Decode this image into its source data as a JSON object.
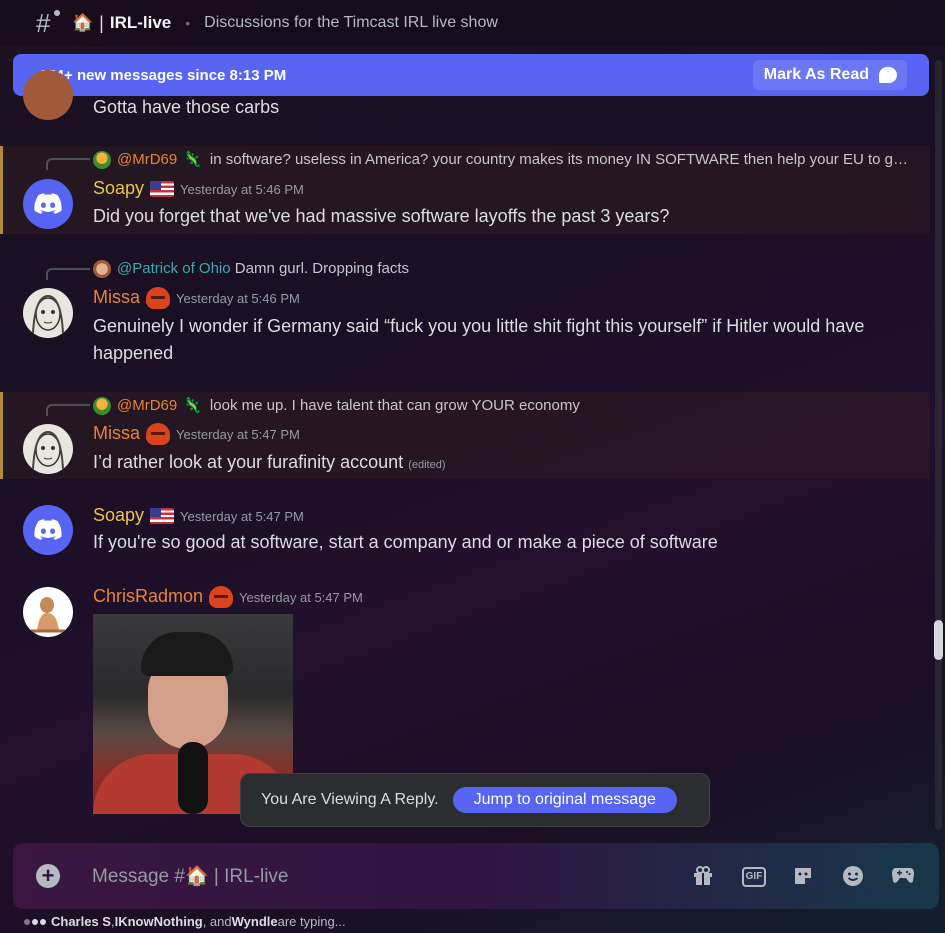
{
  "channel": {
    "name": "IRL-live",
    "house_emoji": "🏠",
    "topic": "Discussions for the Timcast IRL live show"
  },
  "new_messages_bar": {
    "text": "154+ new messages since 8:13 PM",
    "mark_read_label": "Mark As Read"
  },
  "messages": [
    {
      "content": "Gotta have those carbs"
    },
    {
      "reply_to": {
        "name": "@MrD69",
        "text": "in software?  useless in America?  your country makes its money IN SOFTWARE  then help your EU to get its software up!"
      },
      "author": "Soapy",
      "timestamp": "Yesterday at 5:46 PM",
      "content": "Did you forget that we've had massive software layoffs the past 3 years?"
    },
    {
      "reply_to": {
        "name": "@Patrick of Ohio",
        "text": "Damn gurl. Dropping facts"
      },
      "author": "Missa",
      "timestamp": "Yesterday at 5:46 PM",
      "content": "Genuinely I wonder if Germany said “fuck you you little shit fight this yourself” if Hitler would have happened"
    },
    {
      "reply_to": {
        "name": "@MrD69",
        "text": "look me up. I have talent that can grow YOUR economy"
      },
      "author": "Missa",
      "timestamp": "Yesterday at 5:47 PM",
      "content": "I’d rather look at your furafinity account",
      "edited": "(edited)"
    },
    {
      "author": "Soapy",
      "timestamp": "Yesterday at 5:47 PM",
      "content": "If you're so good at software, start a company and or make a piece of software"
    },
    {
      "author": "ChrisRadmon",
      "timestamp": "Yesterday at 5:47 PM"
    }
  ],
  "reply_toast": {
    "text": "You Are Viewing A Reply.",
    "button": "Jump to original message"
  },
  "composer": {
    "placeholder": "Message #🏠 | IRL-live",
    "icons": [
      "add-icon",
      "gift-icon",
      "gif-icon",
      "sticker-icon",
      "emoji-icon",
      "activity-icon"
    ]
  },
  "typing": {
    "users": [
      "Charles S",
      "IKnowNothing",
      "Wyndle"
    ],
    "sep1": ", ",
    "sep2": ", and ",
    "suffix": " are typing..."
  },
  "colors": {
    "accent": "#5865f2",
    "soapy": "#e8c547",
    "missa": "#e8833a",
    "mention_patrick": "#3fa8b4"
  }
}
